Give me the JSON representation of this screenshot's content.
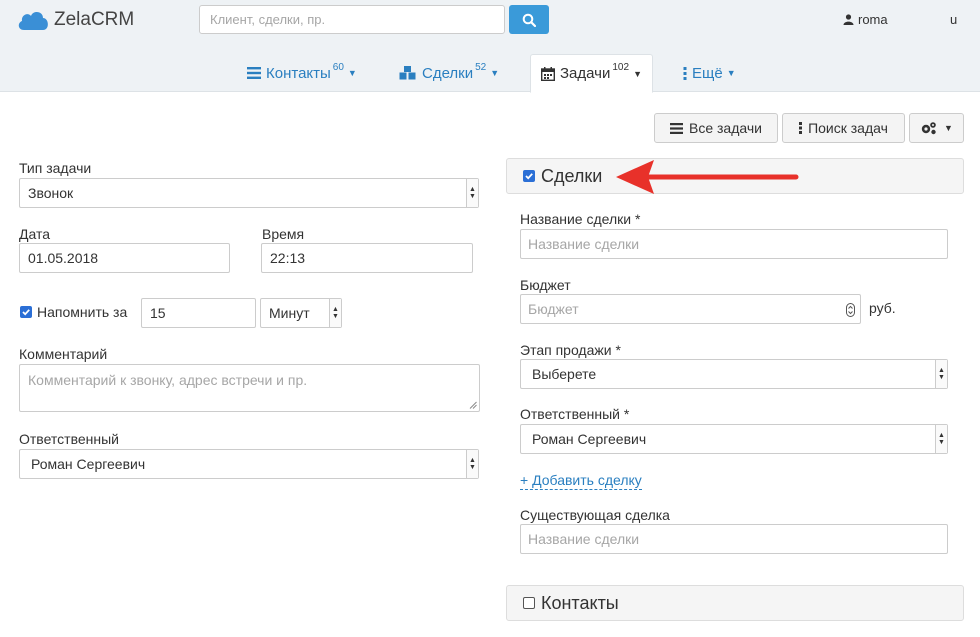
{
  "header": {
    "logo_text": "ZelaCRM",
    "search_placeholder": "Клиент, сделки, пр.",
    "user_name": "roma",
    "lang": "u"
  },
  "nav": {
    "tabs": [
      {
        "label": "Контакты",
        "count": "60"
      },
      {
        "label": "Сделки",
        "count": "52"
      },
      {
        "label": "Задачи",
        "count": "102"
      },
      {
        "label": "Ещё",
        "count": ""
      }
    ]
  },
  "toolbar": {
    "all_tasks": "Все задачи",
    "search_tasks": "Поиск задач"
  },
  "task_form": {
    "type_label": "Тип задачи",
    "type_value": "Звонок",
    "date_label": "Дата",
    "date_value": "01.05.2018",
    "time_label": "Время",
    "time_value": "22:13",
    "remind_label": "Напомнить за",
    "remind_value": "15",
    "remind_unit": "Минут",
    "comment_label": "Комментарий",
    "comment_placeholder": "Комментарий к звонку, адрес встречи и пр.",
    "responsible_label": "Ответственный",
    "responsible_value": "Роман Сергеевич"
  },
  "deals_panel": {
    "title": "Сделки",
    "name_label": "Название сделки *",
    "name_placeholder": "Название сделки",
    "budget_label": "Бюджет",
    "budget_placeholder": "Бюджет",
    "currency": "руб.",
    "stage_label": "Этап продажи *",
    "stage_value": "Выберете",
    "responsible_label": "Ответственный *",
    "responsible_value": "Роман Сергеевич",
    "add_deal": "+ Добавить сделку",
    "existing_label": "Существующая сделка",
    "existing_placeholder": "Название сделки"
  },
  "contacts_panel": {
    "title": "Контакты"
  },
  "colors": {
    "accent": "#2a7fc0",
    "search_button": "#3a9ad9",
    "arrow": "#e8312a",
    "checkbox": "#2b6fd6"
  }
}
